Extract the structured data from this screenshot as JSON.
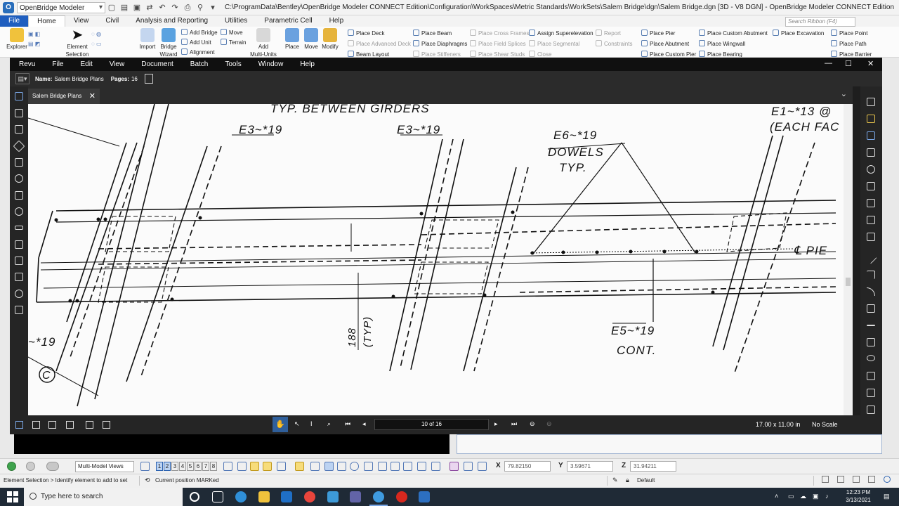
{
  "ob": {
    "app_label": "OpenBridge Modeler",
    "window_title": "C:\\ProgramData\\Bentley\\OpenBridge Modeler CONNECT Edition\\Configuration\\WorkSpaces\\Metric Standards\\WorkSets\\Salem Bridge\\dgn\\Salem Bridge.dgn [3D - V8 DGN] - OpenBridge Modeler CONNECT Edition",
    "tabs": [
      "File",
      "Home",
      "View",
      "Civil",
      "Analysis and Reporting",
      "Utilities",
      "Parametric Cell",
      "Help"
    ],
    "active_tab": "Home",
    "search_placeholder": "Search Ribbon (F4)",
    "ribbon": {
      "explorer": "Explorer",
      "element_selection_1": "Element",
      "element_selection_2": "Selection",
      "import": "Import",
      "bridge_wizard_1": "Bridge",
      "bridge_wizard_2": "Wizard",
      "add_bridge": "Add Bridge",
      "add_unit": "Add Unit",
      "alignment": "Alignment",
      "move": "Move",
      "terrain": "Terrain",
      "add_multi_units_1": "Add",
      "add_multi_units_2": "Multi-Units",
      "place": "Place",
      "move_big": "Move",
      "modify": "Modify",
      "place_deck": "Place Deck",
      "place_advanced_deck": "Place Advanced Deck",
      "beam_layout": "Beam Layout",
      "place_beam": "Place Beam",
      "place_diaphragms": "Place Diaphragms",
      "place_stiffeners": "Place Stiffeners",
      "place_cross_frames": "Place Cross Frames",
      "place_field_splices": "Place Field Splices",
      "place_shear_studs": "Place Shear Studs",
      "assign_superelevation": "Assign Superelevation",
      "place_segmental": "Place Segmental",
      "close": "Close",
      "report": "Report",
      "constraints": "Constraints",
      "place_pier": "Place Pier",
      "place_abutment": "Place Abutment",
      "place_custom_pier": "Place Custom Pier",
      "place_custom_abutment": "Place Custom Abutment",
      "place_wingwall": "Place Wingwall",
      "place_bearing": "Place Bearing",
      "place_excavation": "Place Excavation",
      "place_point": "Place Point",
      "place_path": "Place Path",
      "place_barrier": "Place Barrier"
    },
    "view_dropdown": "Multi-Model Views",
    "view_numbers": [
      "1",
      "2",
      "3",
      "4",
      "5",
      "6",
      "7",
      "8"
    ],
    "coords": {
      "x_label": "X",
      "x": "79.82150",
      "y_label": "Y",
      "y": "3.59671",
      "z_label": "Z",
      "z": "31.94211"
    },
    "status_left": "Element Selection > Identify element to add to set",
    "status_mid": "Current position MARKed",
    "status_level": "Default"
  },
  "revu": {
    "menu": [
      "Revu",
      "File",
      "Edit",
      "View",
      "Document",
      "Batch",
      "Tools",
      "Window",
      "Help"
    ],
    "name_label": "Name:",
    "name_value": "Salem Bridge Plans",
    "pages_label": "Pages:",
    "pages_value": "16",
    "tab_label": "Salem Bridge Plans",
    "page_indicator": "10 of 16",
    "page_size": "17.00 x 11.00 in",
    "scale": "No Scale",
    "window_controls": [
      "—",
      "☐",
      "✕"
    ]
  },
  "drawing": {
    "typ_between": "TYP. BETWEEN GIRDERS",
    "e3_left": "E3~*19",
    "e3_mid": "E3~*19",
    "e1_top": "E1~*13 @",
    "each_face": "(EACH FAC",
    "e6": "E6~*19",
    "dowels": "DOWELS",
    "typ": "TYP.",
    "pier": "℄  PIE",
    "e5": "E5~*19",
    "cont": "CONT.",
    "dim_188": "188",
    "dim_typ": "(TYP)",
    "e19_left": "~*19",
    "circle_c": "C"
  },
  "taskbar": {
    "search_placeholder": "Type here to search",
    "time": "12:23 PM",
    "date": "3/13/2021"
  }
}
